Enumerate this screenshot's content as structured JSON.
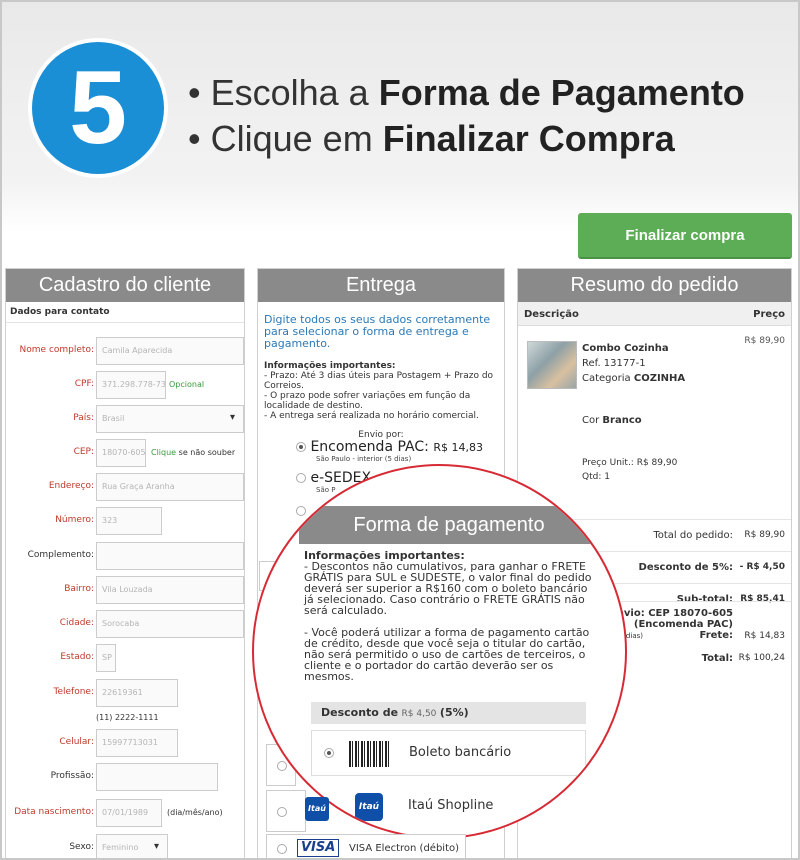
{
  "step": {
    "number": "5",
    "line1_prefix": "• Escolha a ",
    "line1_bold": "Forma de Pagamento",
    "line2_prefix": "• Clique em ",
    "line2_bold": "Finalizar Compra"
  },
  "finalize_button": "Finalizar compra",
  "customer": {
    "title": "Cadastro do cliente",
    "section": "Dados para contato",
    "fields": [
      {
        "label": "Nome completo:",
        "value": "Camila Aparecida",
        "required": true
      },
      {
        "label": "CPF:",
        "value": "371.298.778-73",
        "extra": "Opcional",
        "required": true
      },
      {
        "label": "País:",
        "value": "Brasil",
        "required": true
      },
      {
        "label": "CEP:",
        "value": "18070-605",
        "extra_link": "Clique",
        "extra": "se não souber",
        "required": true
      },
      {
        "label": "Endereço:",
        "value": "Rua Graça Aranha",
        "required": true
      },
      {
        "label": "Número:",
        "value": "323",
        "required": true
      },
      {
        "label": "Complemento:",
        "value": "",
        "required": false
      },
      {
        "label": "Bairro:",
        "value": "Vila Louzada",
        "required": true
      },
      {
        "label": "Cidade:",
        "value": "Sorocaba",
        "required": true
      },
      {
        "label": "Estado:",
        "value": "SP",
        "required": true
      },
      {
        "label": "Telefone:",
        "value": "22619361",
        "hint": "(11) 2222-1111",
        "required": true
      },
      {
        "label": "Celular:",
        "value": "15997713031",
        "required": true
      },
      {
        "label": "Profissão:",
        "value": "",
        "required": false
      },
      {
        "label": "Data nascimento:",
        "value": "07/01/1989",
        "extra": "(dia/mês/ano)",
        "required": true
      },
      {
        "label": "Sexo:",
        "value": "Feminino",
        "required": false
      }
    ]
  },
  "delivery": {
    "title": "Entrega",
    "intro": "Digite todos os seus dados corretamente para selecionar o forma de entrega e pagamento.",
    "info_title": "Informações importantes:",
    "info_lines": [
      "- Prazo: Até 3 dias úteis para Postagem + Prazo do Correios.",
      "- O prazo pode sofrer variações em função da localidade de destino.",
      "- A entrega será realizada no horário comercial."
    ],
    "envio_label": "Envio por:",
    "options": [
      {
        "name": "Encomenda PAC:",
        "price": "R$ 14,83",
        "detail": "São Paulo - interior (5 dias)",
        "selected": true
      },
      {
        "name": "e-SEDEX",
        "price": "",
        "detail": "São P",
        "selected": false
      }
    ]
  },
  "summary": {
    "title": "Resumo do pedido",
    "col_desc": "Descrição",
    "col_price": "Preço",
    "product": {
      "name": "Combo Cozinha",
      "ref": "Ref. 13177-1",
      "category_label": "Categoria",
      "category": "COZINHA",
      "color_label": "Cor",
      "color": "Branco",
      "unit_price": "Preço Unit.: R$ 89,90",
      "qty": "Qtd: 1",
      "price": "R$ 89,90"
    },
    "rows": [
      {
        "label": "Total do pedido:",
        "value": "R$ 89,90",
        "bold": false
      },
      {
        "label": "Desconto de 5%:",
        "value": "- R$ 4,50",
        "bold": true
      },
      {
        "label": "Sub-total:",
        "value": "R$ 85,41",
        "bold": true
      }
    ],
    "shipping_line1": "Envio: CEP 18070-605",
    "shipping_line2": "(Encomenda PAC)",
    "shipping_detail": "o - interior (5 dias)",
    "shipping_label": "Frete:",
    "shipping_value": "R$ 14,83",
    "total_label": "Total:",
    "total_value": "R$ 100,24"
  },
  "payment": {
    "title": "Forma de pagamento",
    "info_title": "Informações importantes:",
    "info_p1": "- Descontos não cumulativos, para ganhar o FRETE GRÁTIS para SUL e SUDESTE, o valor final do pedido deverá ser superior a R$160 com o boleto bancário já selecionado. Caso contrário o FRETE GRÁTIS não será calculado.",
    "info_p2": "- Você poderá utilizar a forma de pagamento cartão de crédito, desde que você seja o titular do cartão, não será permitido o uso de cartões de terceiros, o cliente e o portador do cartão deverão ser os mesmos.",
    "discount_label": "Desconto de",
    "discount_value": "R$ 4,50",
    "discount_pct": "(5%)",
    "options": [
      {
        "label": "Boleto bancário",
        "icon": "barcode-icon",
        "selected": true
      },
      {
        "label": "Itaú Shopline",
        "icon": "itau-logo",
        "logo_text": "Itaú",
        "selected": false
      },
      {
        "label": "VISA Electron (débito)",
        "icon": "visa-logo",
        "logo_text": "VISA",
        "selected": false
      }
    ]
  },
  "colors": {
    "badge": "#1a8fd6",
    "finalize": "#5cad55",
    "panel_header": "#8a8a8a",
    "required_label": "#c0392b",
    "highlight_circle": "#d62b35",
    "delivery_intro": "#2a7ab8"
  }
}
